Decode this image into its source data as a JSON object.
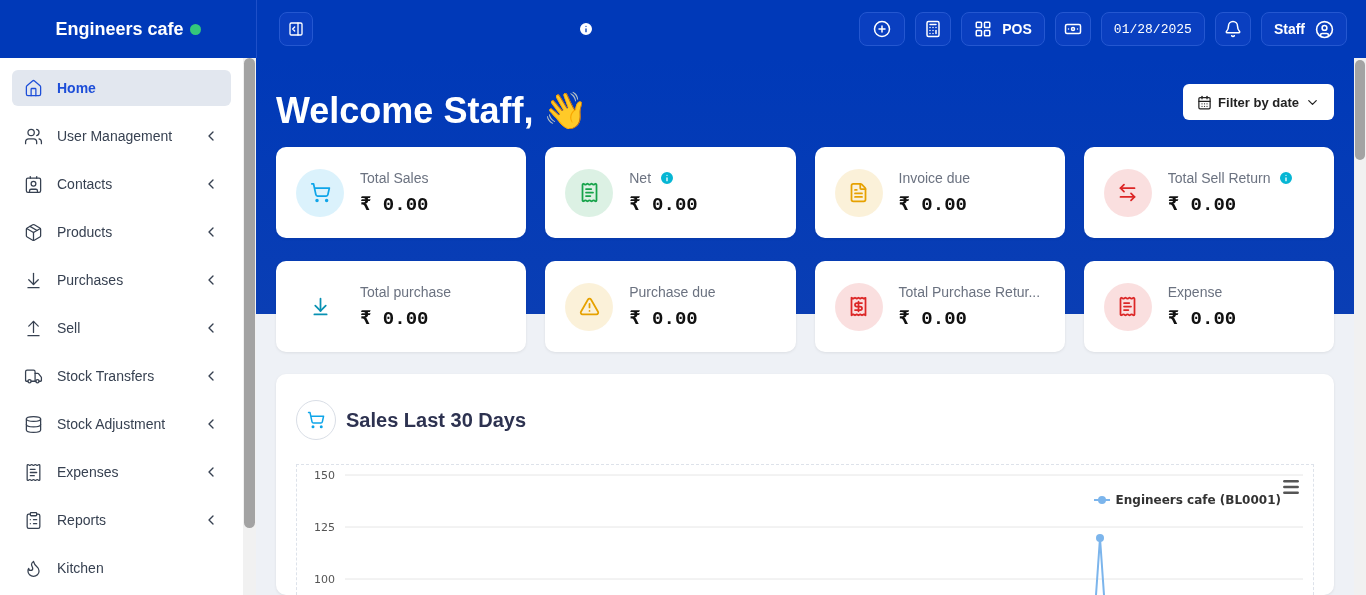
{
  "brand": {
    "name": "Engineers cafe",
    "online": true
  },
  "sidebar": {
    "items": [
      {
        "label": "Home",
        "kind": "home",
        "selected": true,
        "expandable": false
      },
      {
        "label": "User Management",
        "kind": "users",
        "selected": false,
        "expandable": true
      },
      {
        "label": "Contacts",
        "kind": "contacts",
        "selected": false,
        "expandable": true
      },
      {
        "label": "Products",
        "kind": "products",
        "selected": false,
        "expandable": true
      },
      {
        "label": "Purchases",
        "kind": "purchases",
        "selected": false,
        "expandable": true
      },
      {
        "label": "Sell",
        "kind": "sell",
        "selected": false,
        "expandable": true
      },
      {
        "label": "Stock Transfers",
        "kind": "transfers",
        "selected": false,
        "expandable": true
      },
      {
        "label": "Stock Adjustment",
        "kind": "adjustment",
        "selected": false,
        "expandable": true
      },
      {
        "label": "Expenses",
        "kind": "expenses",
        "selected": false,
        "expandable": true
      },
      {
        "label": "Reports",
        "kind": "reports",
        "selected": false,
        "expandable": true
      },
      {
        "label": "Kitchen",
        "kind": "kitchen",
        "selected": false,
        "expandable": false
      }
    ]
  },
  "topbar": {
    "pos_label": "POS",
    "date": "01/28/2025",
    "user": "Staff"
  },
  "welcome": "Welcome Staff, 👋",
  "filter": {
    "label": "Filter by date"
  },
  "stats": [
    {
      "label": "Total Sales",
      "value": "₹ 0.00",
      "kind": "cart",
      "color": "#0ea5e9",
      "info": false
    },
    {
      "label": "Net",
      "value": "₹ 0.00",
      "kind": "receipt",
      "color": "#16a34a",
      "info": true
    },
    {
      "label": "Invoice due",
      "value": "₹ 0.00",
      "kind": "file",
      "color": "#e6a100",
      "info": false
    },
    {
      "label": "Total Sell Return",
      "value": "₹ 0.00",
      "kind": "swap",
      "color": "#dc2626",
      "info": true
    },
    {
      "label": "Total purchase",
      "value": "₹ 0.00",
      "kind": "download",
      "color": "#0891b2",
      "info": false
    },
    {
      "label": "Purchase due",
      "value": "₹ 0.00",
      "kind": "warning",
      "color": "#e6a100",
      "info": false
    },
    {
      "label": "Total Purchase Retur...",
      "value": "₹ 0.00",
      "kind": "return",
      "color": "#dc2626",
      "info": false
    },
    {
      "label": "Expense",
      "value": "₹ 0.00",
      "kind": "receipt",
      "color": "#dc2626",
      "info": false
    }
  ],
  "sales_chart": {
    "title": "Sales Last 30 Days",
    "y_axis_labels": [
      "150",
      "125",
      "100"
    ],
    "legend": [
      {
        "name": "Engineers cafe (BL0001)",
        "color": "#7cb5ec"
      }
    ]
  }
}
